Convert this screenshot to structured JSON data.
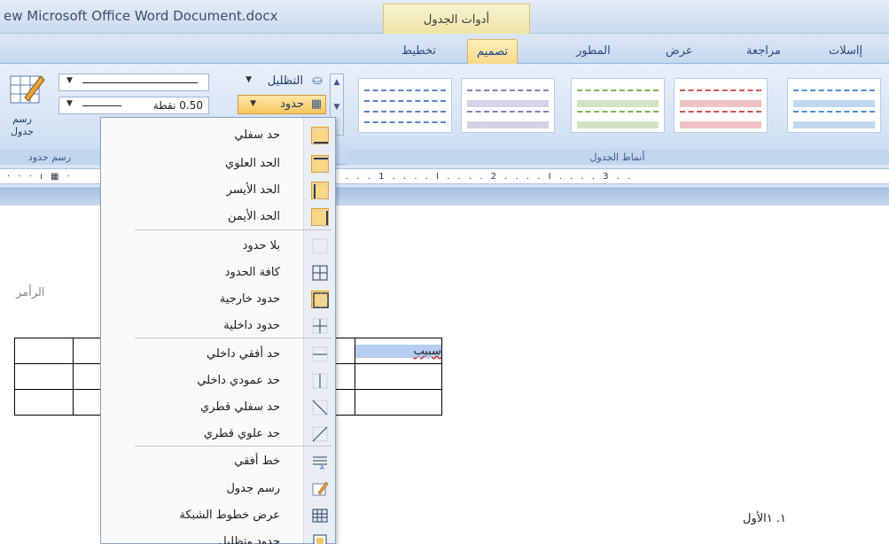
{
  "window": {
    "title": "ew Microsoft Office Word Document.docx",
    "context_tab": "أدوات الجدول"
  },
  "tabs": [
    {
      "label": "تخطيط",
      "active": false
    },
    {
      "label": "تصميم",
      "active": true
    },
    {
      "label": "المطور",
      "active": false
    },
    {
      "label": "عرض",
      "active": false
    },
    {
      "label": "مراجعة",
      "active": false
    },
    {
      "label": "إاسلات",
      "active": false
    }
  ],
  "ribbon": {
    "shading_label": "التظليل",
    "borders_label": "حدود",
    "pen_weight": "0.50 نقطة",
    "draw_table_label": "رسم جدول",
    "draw_group_caption": "رسم حدود",
    "styles_group_caption": "أنماط الجدول",
    "style_colors": [
      "#5a84c4",
      "#8a7db9",
      "#7fb05a",
      "#d05257",
      "#4f8fce"
    ]
  },
  "ruler": {
    "marks": [
      ". . . 1 . . . . I . . . . 2 . . . . I . . . . 3 . ."
    ]
  },
  "document": {
    "header_fragment": "الرأمر",
    "cell_text": "سببب",
    "list_item": "١.   ١الأول"
  },
  "borders_menu": {
    "items": [
      {
        "label": "حد سفلي",
        "icon": "bottom-border-icon",
        "highlighted": true
      },
      {
        "label": "الحد العلوي",
        "icon": "top-border-icon",
        "highlighted": true
      },
      {
        "label": "الحد الأيسر",
        "icon": "left-border-icon",
        "highlighted": true
      },
      {
        "label": "الحد الأيمن",
        "icon": "right-border-icon",
        "highlighted": true
      },
      {
        "label": "بلا حدود",
        "icon": "no-border-icon",
        "highlighted": false
      },
      {
        "label": "كافة الحدود",
        "icon": "all-borders-icon",
        "highlighted": false
      },
      {
        "label": "حدود خارجية",
        "icon": "outside-borders-icon",
        "highlighted": true
      },
      {
        "label": "حدود داخلية",
        "icon": "inside-borders-icon",
        "highlighted": false
      },
      {
        "label": "حد أفقي داخلي",
        "icon": "inside-horizontal-border-icon",
        "highlighted": false
      },
      {
        "label": "حد عمودي داخلي",
        "icon": "inside-vertical-border-icon",
        "highlighted": false
      },
      {
        "label": "حد سفلي قطري",
        "icon": "diagonal-down-border-icon",
        "highlighted": false
      },
      {
        "label": "حد علوي قطري",
        "icon": "diagonal-up-border-icon",
        "highlighted": false
      },
      {
        "label": "خط أفقي",
        "icon": "horizontal-line-icon",
        "highlighted": false
      },
      {
        "label": "رسم جدول",
        "icon": "draw-table-icon",
        "highlighted": false
      },
      {
        "label": "عرض خطوط الشبكة",
        "icon": "view-gridlines-icon",
        "highlighted": false
      },
      {
        "label": "حدود وتظليل",
        "icon": "borders-shading-icon",
        "highlighted": false
      }
    ]
  },
  "colors": {
    "annotation_frame": "#e0191d",
    "highlight_fill": "#fdd784"
  }
}
